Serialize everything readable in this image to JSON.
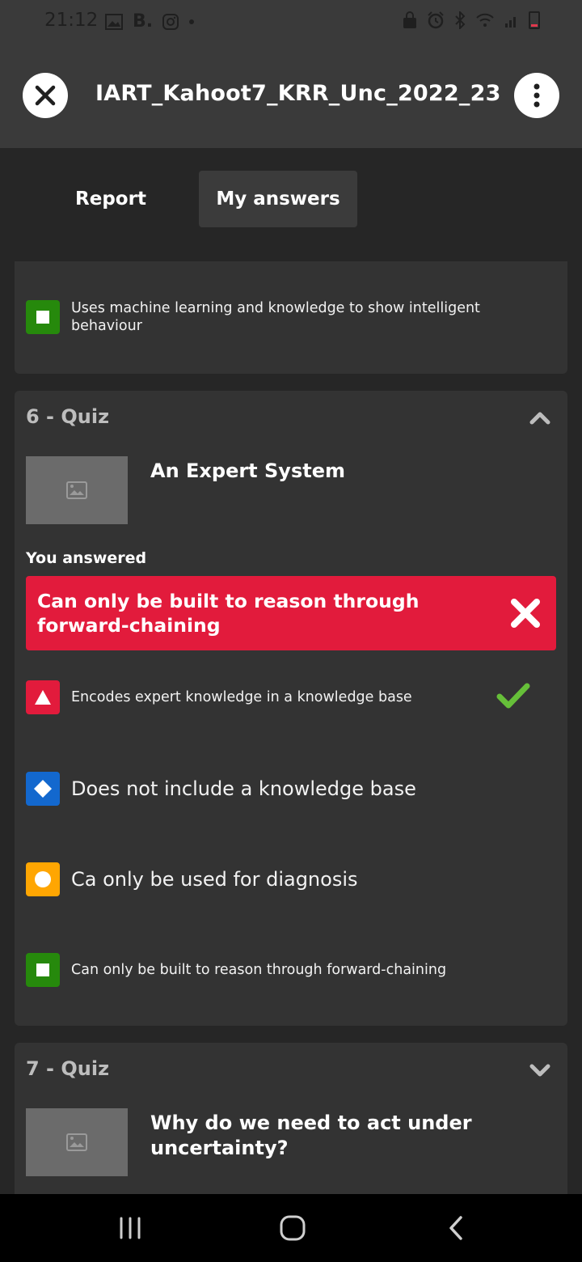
{
  "status_bar": {
    "time": "21:12",
    "left_icons": [
      "gallery-icon",
      "b-app-icon",
      "instagram-icon",
      "dot-icon"
    ],
    "right_icons": [
      "alarm-lock-icon",
      "alarm-icon",
      "bluetooth-icon",
      "wifi-icon",
      "signal-icon",
      "battery-icon"
    ],
    "b_label": "B."
  },
  "header": {
    "title": "IART_Kahoot7_KRR_Unc_2022_23"
  },
  "tabs": [
    {
      "label": "Report",
      "active": false
    },
    {
      "label": "My answers",
      "active": true
    }
  ],
  "prev_card": {
    "option": {
      "shape": "square",
      "color": "#26890c",
      "text": "Uses machine learning and knowledge to show intelligent behaviour"
    }
  },
  "quiz6": {
    "label": "6 - Quiz",
    "question": "An Expert System",
    "you_answered_label": "You answered",
    "answer": "Can only be built to reason through forward-chaining",
    "answer_correct": false,
    "options": [
      {
        "shape": "triangle",
        "color": "#e21b3c",
        "text": "Encodes expert knowledge in a knowledge base",
        "correct": true
      },
      {
        "shape": "diamond",
        "color": "#1368ce",
        "text": "Does not include a knowledge base",
        "correct": false
      },
      {
        "shape": "circle",
        "color": "#ffa602",
        "text": "Ca only be used for diagnosis",
        "correct": false
      },
      {
        "shape": "square",
        "color": "#26890c",
        "text": "Can only be built to reason through forward-chaining",
        "correct": false
      }
    ]
  },
  "quiz7": {
    "label": "7 - Quiz",
    "question_part1": "Why do we need to act under",
    "question_part2": "uncertainty?"
  },
  "colors": {
    "background": "#262626",
    "card": "#333333",
    "header": "#3a3a3a",
    "wrong": "#e21b3c",
    "correct_check": "#66bf39"
  }
}
